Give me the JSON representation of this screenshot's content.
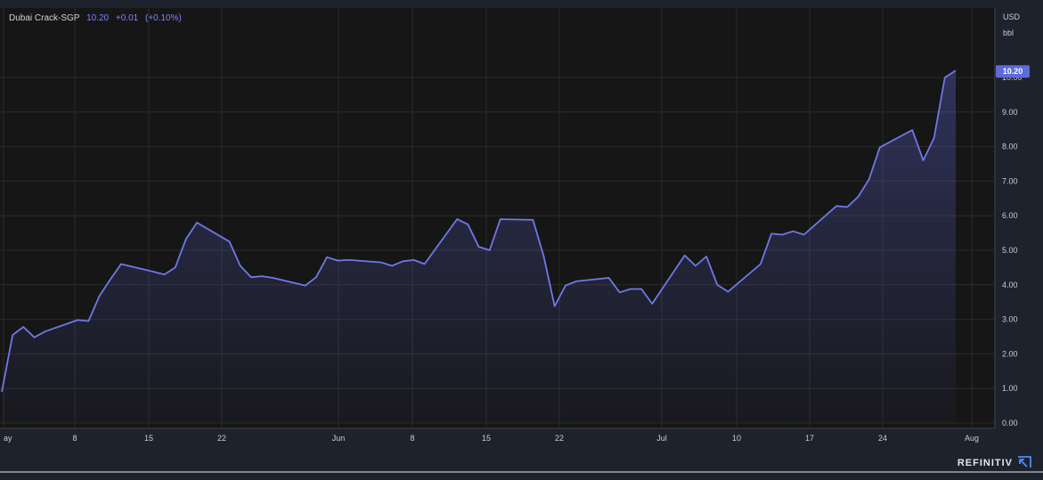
{
  "legend": {
    "name": "Dubai Crack-SGP",
    "value": "10.20",
    "change": "+0.01",
    "change_pct": "(+0.10%)"
  },
  "axis": {
    "unit_line1": "USD",
    "unit_line2": "bbl",
    "last_price_label": "10.20"
  },
  "brand": "REFINITIV",
  "colors": {
    "background": "#1e222d",
    "plot_background": "#161616",
    "line": "#6f78e8",
    "grid": "#2b2b2b",
    "price_tag": "#5f6bd8"
  },
  "chart_data": {
    "type": "area",
    "title": "Dubai Crack-SGP",
    "ylabel": "USD bbl",
    "ylim": [
      0,
      11
    ],
    "grid": true,
    "y_ticks": [
      "0.00",
      "1.00",
      "2.00",
      "3.00",
      "4.00",
      "5.00",
      "6.00",
      "7.00",
      "8.00",
      "9.00",
      "10.00"
    ],
    "x_ticks": [
      "ay",
      "8",
      "15",
      "22",
      "Jun",
      "8",
      "15",
      "22",
      "Jul",
      "10",
      "17",
      "24",
      "Aug"
    ],
    "series": [
      {
        "x": [
          "May 1",
          "May 2",
          "May 3",
          "May 4",
          "May 5",
          "May 8",
          "May 9",
          "May 10",
          "May 11",
          "May 12",
          "May 15",
          "May 16",
          "May 17",
          "May 18",
          "May 19",
          "May 22",
          "May 23",
          "May 24",
          "May 25",
          "May 26",
          "May 29",
          "May 30",
          "May 31",
          "Jun 1",
          "Jun 2",
          "Jun 5",
          "Jun 6",
          "Jun 7",
          "Jun 8",
          "Jun 9",
          "Jun 12",
          "Jun 13",
          "Jun 14",
          "Jun 15",
          "Jun 16",
          "Jun 19",
          "Jun 20",
          "Jun 21",
          "Jun 22",
          "Jun 23",
          "Jun 26",
          "Jun 27",
          "Jun 28",
          "Jun 29",
          "Jun 30",
          "Jul 3",
          "Jul 4",
          "Jul 5",
          "Jul 6",
          "Jul 7",
          "Jul 10",
          "Jul 11",
          "Jul 12",
          "Jul 13",
          "Jul 14",
          "Jul 17",
          "Jul 18",
          "Jul 19",
          "Jul 20",
          "Jul 21",
          "Jul 24",
          "Jul 25",
          "Jul 26",
          "Jul 27",
          "Jul 28"
        ],
        "values": [
          0.9,
          2.55,
          2.78,
          2.48,
          2.65,
          2.98,
          2.95,
          3.67,
          4.15,
          4.6,
          4.38,
          4.3,
          4.5,
          5.33,
          5.8,
          5.25,
          4.55,
          4.22,
          4.25,
          4.2,
          3.98,
          4.22,
          4.8,
          4.7,
          4.72,
          4.65,
          4.55,
          4.68,
          4.72,
          4.6,
          5.9,
          5.75,
          5.1,
          5.0,
          5.9,
          5.88,
          4.82,
          3.38,
          3.98,
          4.1,
          4.2,
          3.78,
          3.88,
          3.88,
          3.45,
          4.85,
          4.55,
          4.82,
          4.0,
          3.8,
          4.6,
          5.48,
          5.45,
          5.55,
          5.45,
          6.28,
          6.25,
          6.55,
          7.05,
          7.98,
          8.48,
          7.6,
          8.25,
          10.0,
          10.2
        ]
      }
    ]
  }
}
